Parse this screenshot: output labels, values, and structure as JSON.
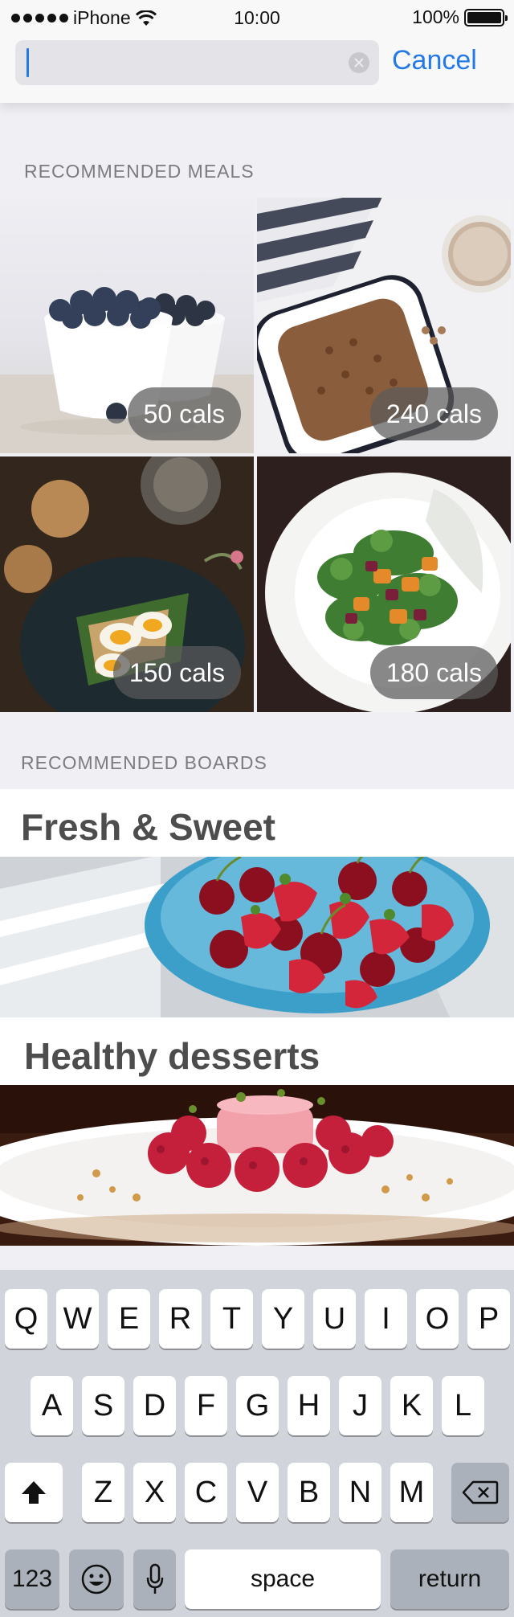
{
  "status_bar": {
    "carrier": "iPhone",
    "time": "10:00",
    "battery": "100%"
  },
  "search": {
    "value": "",
    "placeholder": "",
    "cancel_label": "Cancel"
  },
  "meals_section": {
    "label": "RECOMMENDED MEALS",
    "items": [
      {
        "cals": "50 cals",
        "image": "blueberries-in-white-bowls"
      },
      {
        "cals": "240 cals",
        "image": "granola-tray-with-coffee"
      },
      {
        "cals": "150 cals",
        "image": "egg-avocado-toast-with-cookies"
      },
      {
        "cals": "180 cals",
        "image": "kale-roasted-vegetable-salad"
      }
    ]
  },
  "boards_section": {
    "label": "RECOMMENDED BOARDS",
    "items": [
      {
        "title": "Fresh & Sweet",
        "image": "cherries-strawberries-blue-bowl"
      },
      {
        "title": "Healthy desserts",
        "image": "raspberry-mousse-dessert-plate"
      }
    ]
  },
  "keyboard": {
    "row1": [
      "Q",
      "W",
      "E",
      "R",
      "T",
      "Y",
      "U",
      "I",
      "O",
      "P"
    ],
    "row2": [
      "A",
      "S",
      "D",
      "F",
      "G",
      "H",
      "J",
      "K",
      "L"
    ],
    "row3": [
      "Z",
      "X",
      "C",
      "V",
      "B",
      "N",
      "M"
    ],
    "numbers_label": "123",
    "space_label": "space",
    "return_label": "return"
  },
  "colors": {
    "accent": "#2479e8",
    "background": "#efeff4",
    "keyboard_bg": "#d1d5db"
  }
}
